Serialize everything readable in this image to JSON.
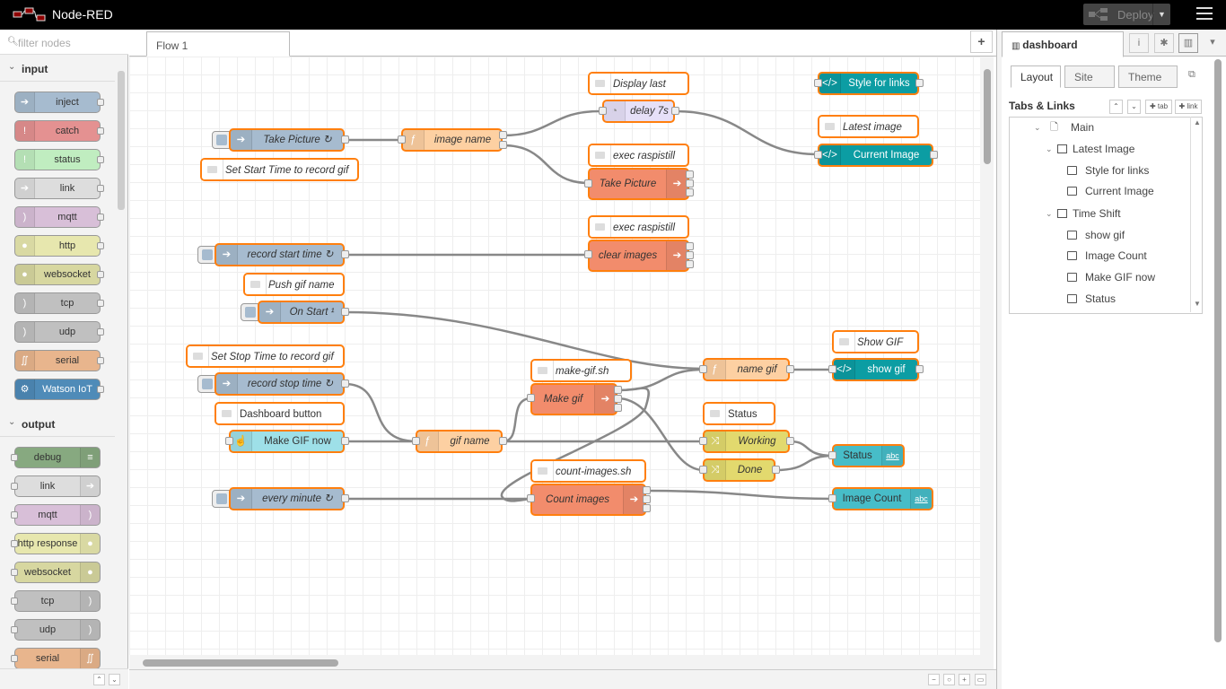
{
  "app": {
    "title": "Node-RED",
    "deploy_label": "Deploy"
  },
  "palette": {
    "search_placeholder": "filter nodes",
    "categories": [
      {
        "name": "input",
        "nodes": [
          "inject",
          "catch",
          "status",
          "link",
          "mqtt",
          "http",
          "websocket",
          "tcp",
          "udp",
          "serial",
          "Watson IoT"
        ]
      },
      {
        "name": "output",
        "nodes": [
          "debug",
          "link",
          "mqtt",
          "http response",
          "websocket",
          "tcp",
          "udp",
          "serial"
        ]
      }
    ]
  },
  "workspace": {
    "tab": "Flow 1",
    "comments": {
      "display_last": "Display last",
      "set_start": "Set Start Time to record gif",
      "exec1": "exec raspistill",
      "exec2": "exec raspistill",
      "push_gif": "Push gif name",
      "set_stop": "Set Stop Time to record gif",
      "dashboard_button": "Dashboard button",
      "makegif_sh": "make-gif.sh",
      "count_sh": "count-images.sh",
      "latest_image": "Latest image",
      "show_gif": "Show GIF",
      "status": "Status"
    },
    "nodes": {
      "take_picture_inject": "Take Picture ↻",
      "image_name": "image name",
      "delay": "delay 7s",
      "take_picture_exec": "Take Picture",
      "style_links": "Style for links",
      "current_image": "Current Image",
      "record_start": "record start time ↻",
      "clear_images": "clear images",
      "on_start": "On Start ¹",
      "record_stop": "record stop time ↻",
      "make_gif_btn": "Make GIF now",
      "gif_name": "gif name",
      "make_gif": "Make gif",
      "name_gif": "name gif",
      "show_gif": "show gif",
      "working": "Working",
      "done": "Done",
      "status": "Status",
      "every_minute": "every minute ↻",
      "count_images": "Count images",
      "image_count": "Image Count"
    }
  },
  "sidebar": {
    "tab": "dashboard",
    "subtabs": [
      "Layout",
      "Site",
      "Theme"
    ],
    "section_title": "Tabs & Links",
    "btn_tab": "✚ tab",
    "btn_link": "✚ link",
    "tree": {
      "main": "Main",
      "groups": [
        {
          "name": "Latest Image",
          "items": [
            "Style for links",
            "Current Image"
          ]
        },
        {
          "name": "Time Shift",
          "items": [
            "show gif",
            "Image Count",
            "Make GIF now",
            "Status"
          ]
        }
      ]
    }
  },
  "colors": {
    "inject": "#a6bbcf",
    "function": "#fdd0a2",
    "exec": "#f28c6c",
    "template": "#0c9da3",
    "switch": "#e2d96e",
    "ui_text": "#47bdc8",
    "button": "#9ee0e8",
    "selected": "#ff7f0e"
  }
}
